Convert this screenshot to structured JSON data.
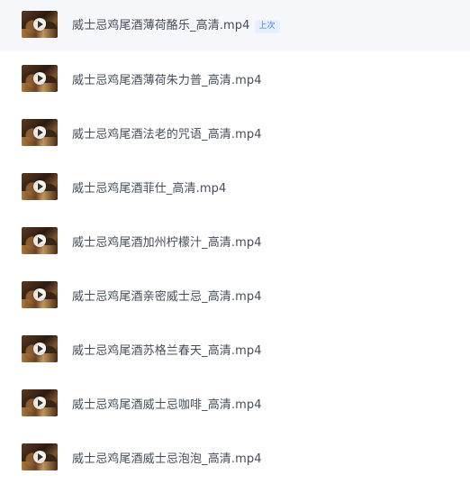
{
  "files": [
    {
      "name": "威士忌鸡尾酒薄荷酪乐_高清.mp4",
      "badge": "上次"
    },
    {
      "name": "威士忌鸡尾酒薄荷朱力普_高清.mp4"
    },
    {
      "name": "威士忌鸡尾酒法老的咒语_高清.mp4"
    },
    {
      "name": "威士忌鸡尾酒菲仕_高清.mp4"
    },
    {
      "name": "威士忌鸡尾酒加州柠檬汁_高清.mp4"
    },
    {
      "name": "威士忌鸡尾酒亲密威士忌_高清.mp4"
    },
    {
      "name": "威士忌鸡尾酒苏格兰春天_高清.mp4"
    },
    {
      "name": "威士忌鸡尾酒威士忌咖啡_高清.mp4"
    },
    {
      "name": "威士忌鸡尾酒威士忌泡泡_高清.mp4"
    }
  ],
  "icons": {
    "thumbnail": "video-thumbnail-icon",
    "play": "play-icon"
  },
  "colors": {
    "text": "#454d5a",
    "badge_text": "#3d7ef6",
    "badge_bg": "#e6efff"
  }
}
